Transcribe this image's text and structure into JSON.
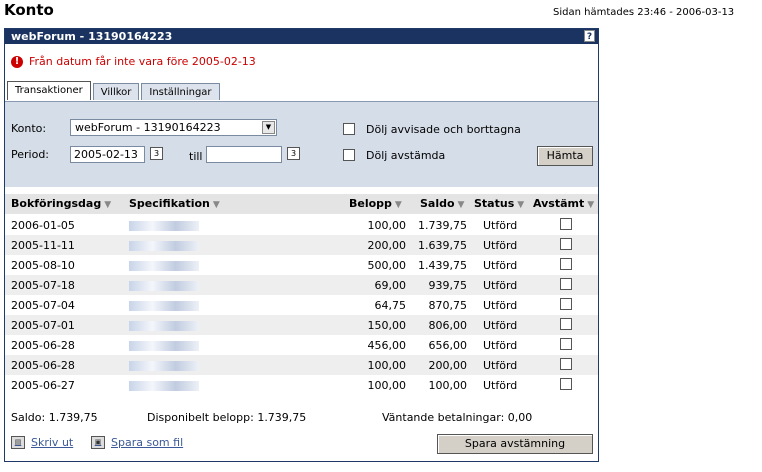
{
  "page": {
    "title": "Konto",
    "fetched": "Sidan hämtades 23:46 - 2006-03-13"
  },
  "panel": {
    "title": "webForum - 13190164223",
    "help": "?"
  },
  "error": {
    "text": "Från datum får inte vara före 2005-02-13"
  },
  "tabs": [
    {
      "label": "Transaktioner"
    },
    {
      "label": "Villkor"
    },
    {
      "label": "Inställningar"
    }
  ],
  "filter": {
    "konto_label": "Konto:",
    "konto_value": "webForum - 13190164223",
    "period_label": "Period:",
    "from_value": "2005-02-13",
    "till_label": "till",
    "to_value": "",
    "hide_rejected_label": "Dölj avvisade och borttagna",
    "hide_reconciled_label": "Dölj avstämda",
    "fetch_label": "Hämta"
  },
  "table": {
    "columns": [
      "Bokföringsdag",
      "Specifikation",
      "Belopp",
      "Saldo",
      "Status",
      "Avstämt"
    ],
    "rows": [
      {
        "date": "2006-01-05",
        "belopp": "100,00",
        "saldo": "1.739,75",
        "status": "Utförd"
      },
      {
        "date": "2005-11-11",
        "belopp": "200,00",
        "saldo": "1.639,75",
        "status": "Utförd"
      },
      {
        "date": "2005-08-10",
        "belopp": "500,00",
        "saldo": "1.439,75",
        "status": "Utförd"
      },
      {
        "date": "2005-07-18",
        "belopp": "69,00",
        "saldo": "939,75",
        "status": "Utförd"
      },
      {
        "date": "2005-07-04",
        "belopp": "64,75",
        "saldo": "870,75",
        "status": "Utförd"
      },
      {
        "date": "2005-07-01",
        "belopp": "150,00",
        "saldo": "806,00",
        "status": "Utförd"
      },
      {
        "date": "2005-06-28",
        "belopp": "456,00",
        "saldo": "656,00",
        "status": "Utförd"
      },
      {
        "date": "2005-06-28",
        "belopp": "100,00",
        "saldo": "200,00",
        "status": "Utförd"
      },
      {
        "date": "2005-06-27",
        "belopp": "100,00",
        "saldo": "100,00",
        "status": "Utförd"
      }
    ]
  },
  "summary": {
    "saldo": "Saldo: 1.739,75",
    "disponibelt": "Disponibelt belopp: 1.739,75",
    "vantande": "Väntande betalningar: 0,00"
  },
  "actions": {
    "print": "Skriv ut",
    "save_file": "Spara som fil",
    "save_reconcile": "Spara avstämning"
  }
}
